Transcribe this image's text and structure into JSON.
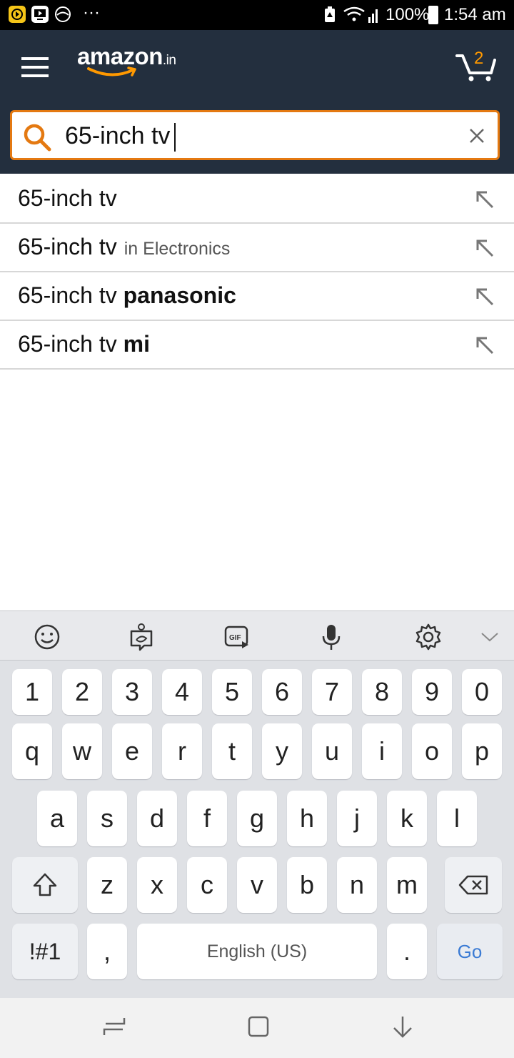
{
  "status_bar": {
    "battery": "100%",
    "time": "1:54 am",
    "more": "···"
  },
  "header": {
    "logo": "amazon",
    "logo_suffix": ".in",
    "cart_count": "2"
  },
  "search": {
    "query": "65-inch tv"
  },
  "suggestions": [
    {
      "prefix": "65-inch tv",
      "bold": "",
      "department": ""
    },
    {
      "prefix": "65-inch tv",
      "bold": "",
      "department": "in Electronics"
    },
    {
      "prefix": "65-inch tv ",
      "bold": "panasonic",
      "department": ""
    },
    {
      "prefix": "65-inch tv ",
      "bold": "mi",
      "department": ""
    }
  ],
  "keyboard": {
    "number_row": [
      "1",
      "2",
      "3",
      "4",
      "5",
      "6",
      "7",
      "8",
      "9",
      "0"
    ],
    "row1": [
      "q",
      "w",
      "e",
      "r",
      "t",
      "y",
      "u",
      "i",
      "o",
      "p"
    ],
    "row2": [
      "a",
      "s",
      "d",
      "f",
      "g",
      "h",
      "j",
      "k",
      "l"
    ],
    "row3": [
      "z",
      "x",
      "c",
      "v",
      "b",
      "n",
      "m"
    ],
    "symbols_key": "!#1",
    "comma_key": ",",
    "space_key": "English (US)",
    "period_key": ".",
    "go_key": "Go",
    "toolbar_icons": [
      "emoji-icon",
      "sticker-icon",
      "gif-icon",
      "microphone-icon",
      "settings-icon",
      "collapse-chevron-icon"
    ]
  },
  "colors": {
    "header_bg": "#232f3e",
    "accent_orange": "#e47911",
    "go_blue": "#3b7bd4"
  }
}
